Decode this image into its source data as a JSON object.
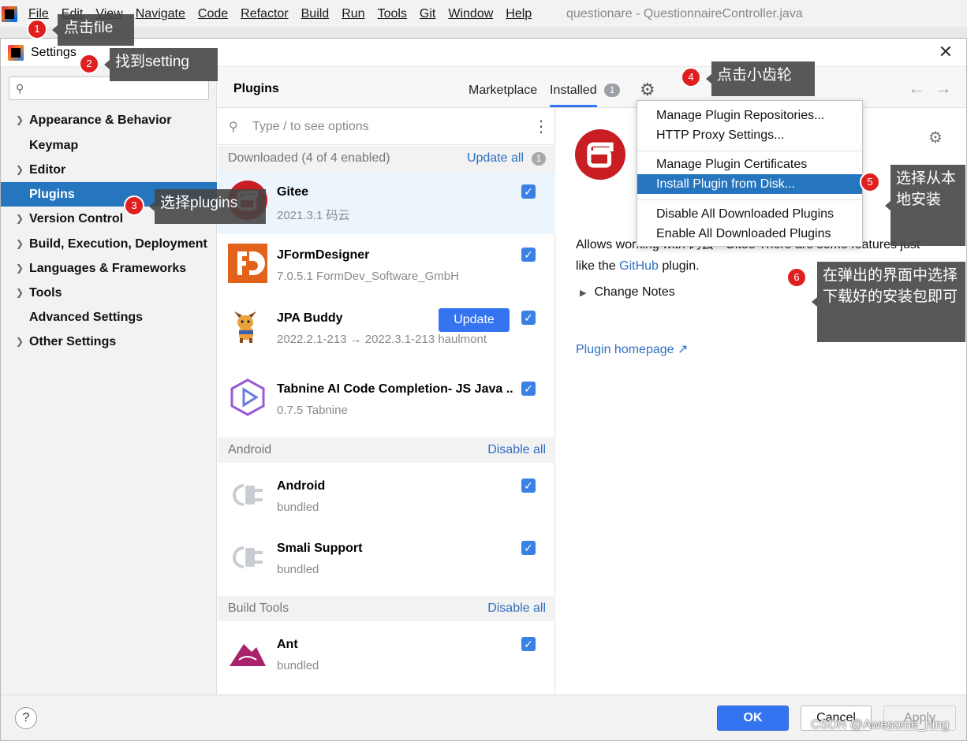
{
  "menubar": {
    "items": [
      "File",
      "Edit",
      "View",
      "Navigate",
      "Code",
      "Refactor",
      "Build",
      "Run",
      "Tools",
      "Git",
      "Window",
      "Help"
    ],
    "title": "questionare - QuestionnaireController.java"
  },
  "dialog": {
    "title": "Settings",
    "close_glyph": "✕",
    "search_placeholder": ""
  },
  "sidebar": {
    "items": [
      {
        "label": "Appearance & Behavior",
        "expandable": true
      },
      {
        "label": "Keymap",
        "expandable": false
      },
      {
        "label": "Editor",
        "expandable": true
      },
      {
        "label": "Plugins",
        "expandable": false,
        "selected": true
      },
      {
        "label": "Version Control",
        "expandable": true
      },
      {
        "label": "Build, Execution, Deployment",
        "expandable": true
      },
      {
        "label": "Languages & Frameworks",
        "expandable": true
      },
      {
        "label": "Tools",
        "expandable": true
      },
      {
        "label": "Advanced Settings",
        "expandable": false
      },
      {
        "label": "Other Settings",
        "expandable": true
      }
    ]
  },
  "plugins": {
    "title": "Plugins",
    "tabs": {
      "marketplace": "Marketplace",
      "installed": "Installed",
      "installed_badge": "1"
    },
    "search_placeholder": "Type / to see options",
    "groups": {
      "downloaded": {
        "label": "Downloaded (4 of 4 enabled)",
        "action": "Update all",
        "badge": "1"
      },
      "android": {
        "label": "Android",
        "action": "Disable all"
      },
      "build_tools": {
        "label": "Build Tools",
        "action": "Disable all"
      }
    },
    "list": [
      {
        "name": "Gitee",
        "meta": "2021.3.1  码云",
        "checked": true,
        "selected": true
      },
      {
        "name": "JFormDesigner",
        "meta": "7.0.5.1  FormDev_Software_GmbH",
        "checked": true
      },
      {
        "name": "JPA Buddy",
        "meta": "2022.2.1-213 → 2022.3.1-213  haulmont",
        "checked": true,
        "update_label": "Update"
      },
      {
        "name": "Tabnine AI Code Completion- JS Java ...",
        "meta": "0.7.5  Tabnine",
        "checked": true
      },
      {
        "name": "Android",
        "meta": "bundled",
        "checked": true
      },
      {
        "name": "Smali Support",
        "meta": "bundled",
        "checked": true
      },
      {
        "name": "Ant",
        "meta": "bundled",
        "checked": true
      }
    ]
  },
  "detail": {
    "desc_line1": "Allows working with 码云 - Gitee There are some features just",
    "desc_line2_pre": "like the ",
    "desc_link": "GitHub",
    "desc_line2_post": " plugin.",
    "change_notes": "Change Notes",
    "homepage": "Plugin homepage ↗"
  },
  "gear_menu": {
    "items": [
      "Manage Plugin Repositories...",
      "HTTP Proxy Settings...",
      "Manage Plugin Certificates",
      "Install Plugin from Disk...",
      "Disable All Downloaded Plugins",
      "Enable All Downloaded Plugins"
    ],
    "highlighted": "Install Plugin from Disk..."
  },
  "footer": {
    "help": "?",
    "ok": "OK",
    "cancel": "Cancel",
    "apply": "Apply"
  },
  "watermark": "CSDN @Awesome_ning",
  "annotations": [
    {
      "num": "1",
      "text": "点击file"
    },
    {
      "num": "2",
      "text": "找到setting"
    },
    {
      "num": "3",
      "text": "选择plugins"
    },
    {
      "num": "4",
      "text": "点击小齿轮"
    },
    {
      "num": "5",
      "text": "选择从本地安装"
    },
    {
      "num": "6",
      "text": "在弹出的界面中选择下载好的安装包即可"
    }
  ],
  "colors": {
    "accent": "#3474f0",
    "selection": "#2675bf",
    "annotation_red": "#e02020",
    "gitee_red": "#c71d23"
  }
}
